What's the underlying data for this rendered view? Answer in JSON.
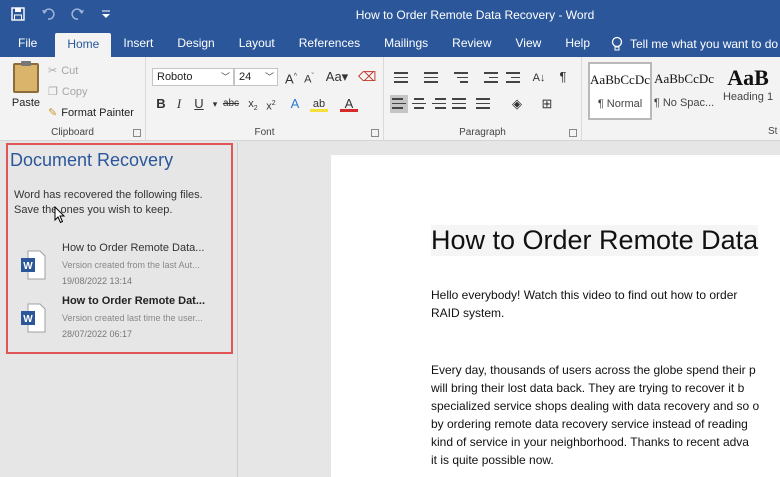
{
  "window": {
    "title": "How to Order Remote Data Recovery  -  Word"
  },
  "tabs": [
    "File",
    "Home",
    "Insert",
    "Design",
    "Layout",
    "References",
    "Mailings",
    "Review",
    "View",
    "Help"
  ],
  "tell_me": "Tell me what you want to do",
  "clipboard": {
    "paste": "Paste",
    "cut": "Cut",
    "copy": "Copy",
    "format_painter": "Format Painter",
    "label": "Clipboard"
  },
  "font": {
    "family": "Roboto",
    "size": "24",
    "label": "Font"
  },
  "paragraph": {
    "label": "Paragraph"
  },
  "styles": [
    {
      "sample": "AaBbCcDc",
      "name": "¶ Normal"
    },
    {
      "sample": "AaBbCcDc",
      "name": "¶ No Spac..."
    },
    {
      "sample": "AaB",
      "name": "Heading 1"
    }
  ],
  "styles_label": "St",
  "recovery": {
    "title": "Document Recovery",
    "description_line1": "Word has recovered the following files.",
    "description_line2": "Save the ones you wish to keep.",
    "files": [
      {
        "name": "How to Order Remote Data...",
        "detail": "Version created from the last Aut...",
        "date": "19/08/2022 13:14"
      },
      {
        "name": "How to Order Remote Dat...",
        "detail": "Version created last time the user...",
        "date": "28/07/2022 06:17"
      }
    ]
  },
  "document": {
    "heading": "How to Order Remote Data",
    "paragraphs": [
      "Hello everybody! Watch this video to find out how to order",
      "RAID system.",
      "Every day, thousands of users across the globe spend their p",
      "will bring their lost data back. They are trying to recover it b",
      "specialized service shops dealing with data recovery and so o",
      "by ordering remote data recovery service instead of reading",
      "kind of service in your neighborhood. Thanks to recent adva",
      "it is quite possible now."
    ]
  },
  "colors": {
    "accent": "#2b579a",
    "highlight_border": "#e05555"
  }
}
